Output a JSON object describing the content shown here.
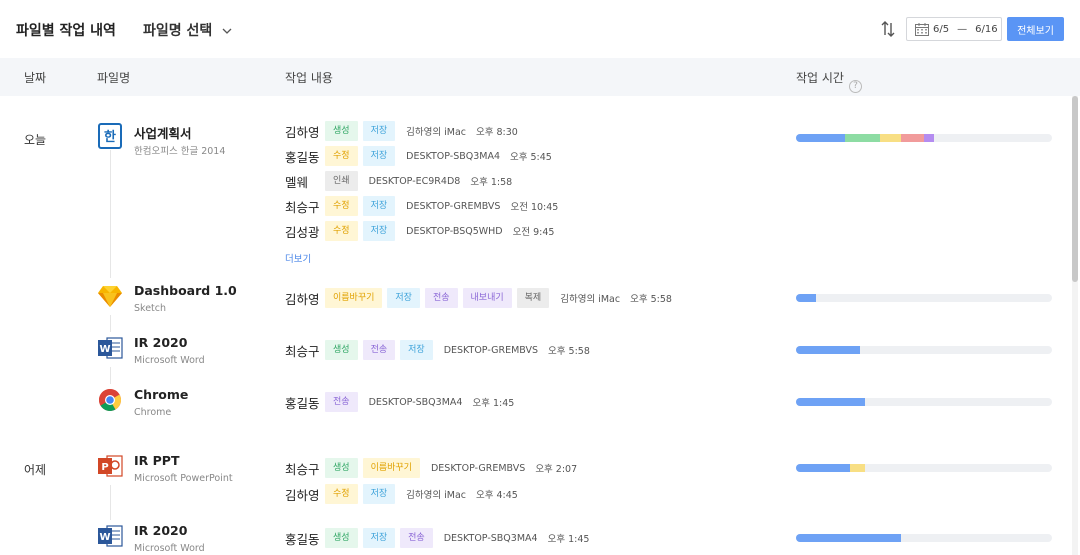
{
  "header": {
    "title": "파일별 작업 내역",
    "file_select": "파일명 선택",
    "date_from": "6/5",
    "date_sep": "—",
    "date_to": "6/16",
    "view_all": "전체보기"
  },
  "columns": {
    "date": "날짜",
    "file": "파일명",
    "work": "작업 내용",
    "time": "작업 시간"
  },
  "colors": {
    "accent": "#5a95f5",
    "bar_blue": "#6ea2f5",
    "bar_green": "#8ddca3",
    "bar_yellow": "#f8df84",
    "bar_red": "#f19b9b",
    "bar_purple": "#b48cf0"
  },
  "days": [
    {
      "label": "오늘"
    },
    {
      "label": "어제"
    }
  ],
  "files": [
    {
      "name": "사업계획서",
      "app": "한컴오피스 한글 2014",
      "icon": "hancom-hwp-icon",
      "rows": [
        {
          "user": "김하영",
          "tags": [
            {
              "label": "생성",
              "c": "green"
            },
            {
              "label": "저장",
              "c": "blue"
            }
          ],
          "device": "김하영의 iMac",
          "time": "오후 8:30"
        },
        {
          "user": "홍길동",
          "tags": [
            {
              "label": "수정",
              "c": "yellow"
            },
            {
              "label": "저장",
              "c": "blue"
            }
          ],
          "device": "DESKTOP-SBQ3MA4",
          "time": "오후 5:45"
        },
        {
          "user": "멜웨",
          "tags": [
            {
              "label": "인쇄",
              "c": "gray"
            }
          ],
          "device": "DESKTOP-EC9R4D8",
          "time": "오후 1:58"
        },
        {
          "user": "최승구",
          "tags": [
            {
              "label": "수정",
              "c": "yellow"
            },
            {
              "label": "저장",
              "c": "blue"
            }
          ],
          "device": "DESKTOP-GREMBVS",
          "time": "오전 10:45"
        },
        {
          "user": "김성광",
          "tags": [
            {
              "label": "수정",
              "c": "yellow"
            },
            {
              "label": "저장",
              "c": "blue"
            }
          ],
          "device": "DESKTOP-BSQ5WHD",
          "time": "오전 9:45"
        }
      ],
      "more": "더보기",
      "bar": [
        {
          "c": "blue",
          "v": 0.19
        },
        {
          "c": "green",
          "v": 0.14
        },
        {
          "c": "yellow",
          "v": 0.08
        },
        {
          "c": "red",
          "v": 0.09
        },
        {
          "c": "purple",
          "v": 0.04
        }
      ]
    },
    {
      "name": "Dashboard 1.0",
      "app": "Sketch",
      "icon": "sketch-icon",
      "rows": [
        {
          "user": "김하영",
          "tags": [
            {
              "label": "이름바꾸기",
              "c": "yellow"
            },
            {
              "label": "저장",
              "c": "blue"
            },
            {
              "label": "전송",
              "c": "purple"
            },
            {
              "label": "내보내기",
              "c": "purple"
            },
            {
              "label": "복제",
              "c": "gray"
            }
          ],
          "device": "김하영의 iMac",
          "time": "오후 5:58"
        }
      ],
      "bar": [
        {
          "c": "blue",
          "v": 0.08
        }
      ]
    },
    {
      "name": "IR 2020",
      "app": "Microsoft Word",
      "icon": "word-icon",
      "rows": [
        {
          "user": "최승구",
          "tags": [
            {
              "label": "생성",
              "c": "green"
            },
            {
              "label": "전송",
              "c": "purple"
            },
            {
              "label": "저장",
              "c": "blue"
            }
          ],
          "device": "DESKTOP-GREMBVS",
          "time": "오후 5:58"
        }
      ],
      "bar": [
        {
          "c": "blue",
          "v": 0.25
        }
      ]
    },
    {
      "name": "Chrome",
      "app": "Chrome",
      "icon": "chrome-icon",
      "rows": [
        {
          "user": "홍길동",
          "tags": [
            {
              "label": "전송",
              "c": "purple"
            }
          ],
          "device": "DESKTOP-SBQ3MA4",
          "time": "오후 1:45"
        }
      ],
      "bar": [
        {
          "c": "blue",
          "v": 0.27
        }
      ]
    },
    {
      "name": "IR PPT",
      "app": "Microsoft PowerPoint",
      "icon": "powerpoint-icon",
      "rows": [
        {
          "user": "최승구",
          "tags": [
            {
              "label": "생성",
              "c": "green"
            },
            {
              "label": "이름바꾸기",
              "c": "yellow"
            }
          ],
          "device": "DESKTOP-GREMBVS",
          "time": "오후 2:07"
        },
        {
          "user": "김하영",
          "tags": [
            {
              "label": "수정",
              "c": "yellow"
            },
            {
              "label": "저장",
              "c": "blue"
            }
          ],
          "device": "김하영의 iMac",
          "time": "오후 4:45"
        }
      ],
      "bar": [
        {
          "c": "blue",
          "v": 0.21
        },
        {
          "c": "yellow",
          "v": 0.06
        }
      ]
    },
    {
      "name": "IR 2020",
      "app": "Microsoft Word",
      "icon": "word-icon",
      "rows": [
        {
          "user": "홍길동",
          "tags": [
            {
              "label": "생성",
              "c": "green"
            },
            {
              "label": "저장",
              "c": "blue"
            },
            {
              "label": "전송",
              "c": "purple"
            }
          ],
          "device": "DESKTOP-SBQ3MA4",
          "time": "오후 1:45"
        }
      ],
      "bar": [
        {
          "c": "blue",
          "v": 0.41
        }
      ]
    }
  ]
}
